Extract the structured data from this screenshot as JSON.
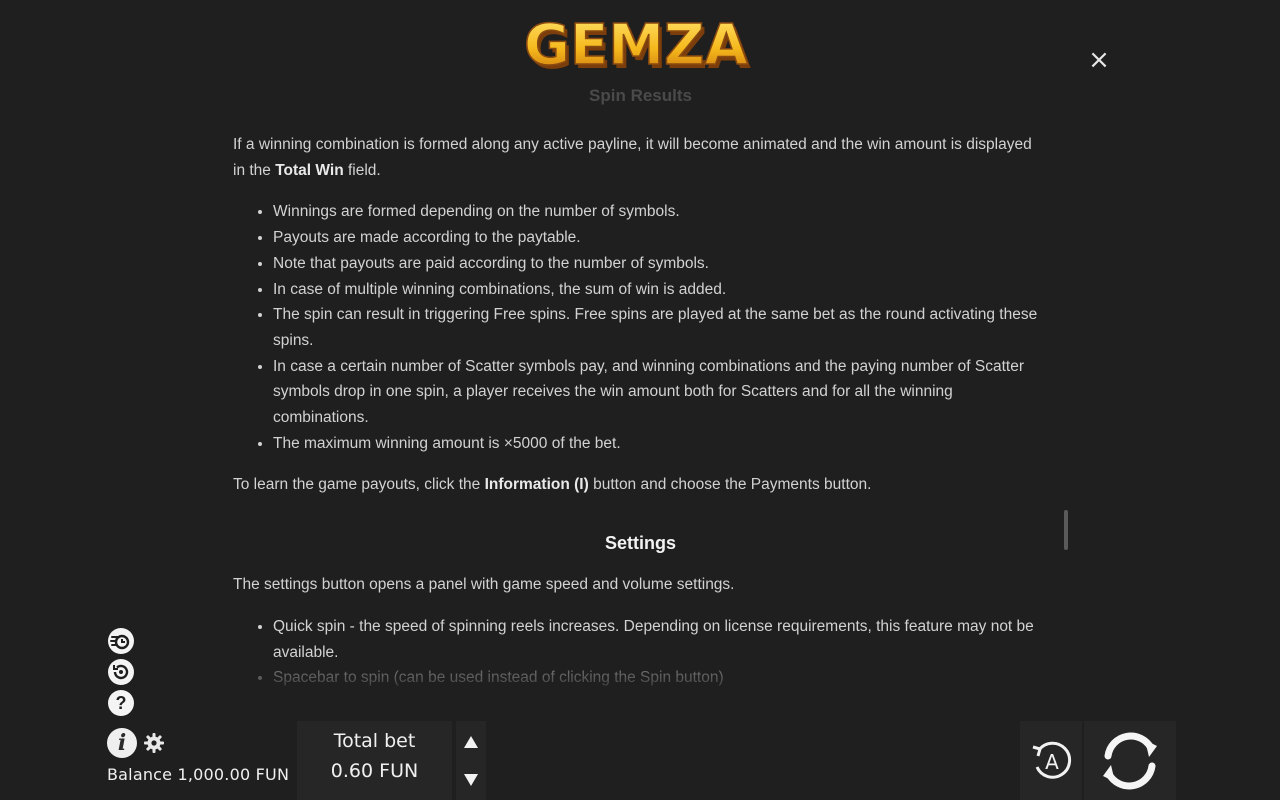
{
  "logo": {
    "text": "GEMZA"
  },
  "close": {
    "icon": "×"
  },
  "content": {
    "faded_heading": "Spin Results",
    "para1_before": "If a winning combination is formed along any active payline, it will become animated and the win amount is displayed in the ",
    "para1_bold": "Total Win",
    "para1_after": " field.",
    "list1": [
      "Winnings are formed depending on the number of symbols.",
      "Payouts are made according to the paytable.",
      "Note that payouts are paid according to the number of symbols.",
      "In case of multiple winning combinations, the sum of win is added.",
      "The spin can result in triggering Free spins. Free spins are played at the same bet as the round activating these spins.",
      "In case a certain number of Scatter symbols pay, and winning combinations and the paying number of Scatter symbols drop in one spin, a player receives the win amount both for Scatters and for all the winning combinations.",
      "The maximum winning amount is ×5000 of the bet."
    ],
    "para2_before": "To learn the game payouts, click the ",
    "para2_bold": "Information (I)",
    "para2_after": " button and choose the Payments button.",
    "settings_title": "Settings",
    "para3": "The settings button opens a panel with game speed and volume settings.",
    "list2": [
      "Quick spin - the speed of spinning reels increases. Depending on license requirements, this feature may not be available.",
      "Spacebar to spin (can be used instead of clicking the Spin button)"
    ]
  },
  "side": {
    "icons": [
      "turbo-icon",
      "history-icon",
      "help-icon"
    ],
    "help_glyph": "?",
    "info_glyph": "i"
  },
  "balance": {
    "text": "Balance 1,000.00 FUN"
  },
  "bet": {
    "label": "Total bet",
    "value": "0.60 FUN"
  },
  "autoplay": {
    "letter": "A"
  },
  "colors": {
    "background": "#1f1f1f",
    "panel": "#262626",
    "text": "#d2d2d2",
    "logo_gold": "#f5b81c"
  }
}
